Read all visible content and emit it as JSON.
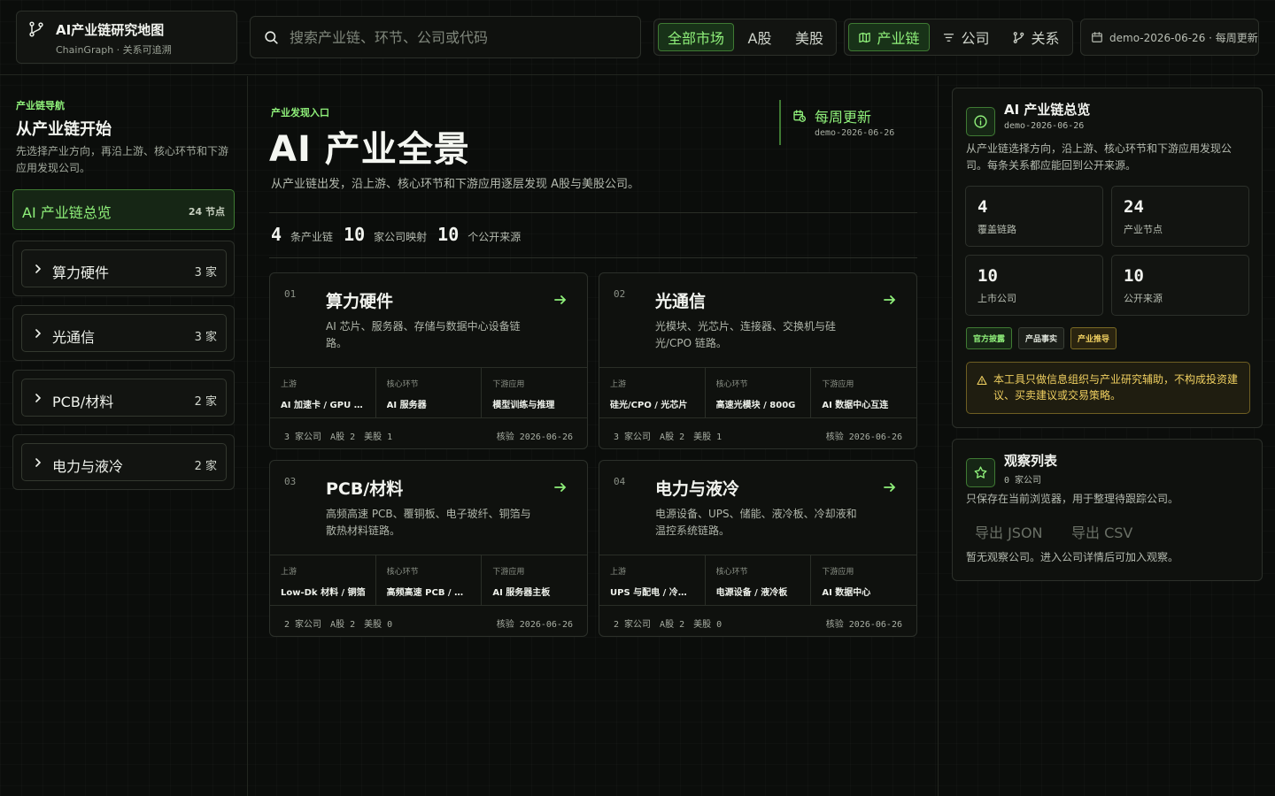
{
  "header": {
    "app_title": "AI产业链研究地图",
    "app_subtitle": "ChainGraph · 关系可追溯",
    "search_placeholder": "搜索产业链、环节、公司或代码",
    "market_tabs": [
      "全部市场",
      "A股",
      "美股"
    ],
    "view_tabs": [
      "产业链",
      "公司",
      "关系"
    ],
    "data_version": "demo-2026-06-26 · 每周更新",
    "accent_color": "#8ff07a"
  },
  "sidebar": {
    "eyebrow": "产业链导航",
    "title": "从产业链开始",
    "description": "先选择产业方向，再沿上游、核心环节和下游应用发现公司。",
    "overview": {
      "label": "AI 产业链总览",
      "count": "24 节点"
    },
    "items": [
      {
        "label": "算力硬件",
        "count": "3 家"
      },
      {
        "label": "光通信",
        "count": "3 家"
      },
      {
        "label": "PCB/材料",
        "count": "2 家"
      },
      {
        "label": "电力与液冷",
        "count": "2 家"
      }
    ]
  },
  "main": {
    "eyebrow": "产业发现入口",
    "title": "AI 产业全景",
    "description": "从产业链出发，沿上游、核心环节和下游应用逐层发现 A股与美股公司。",
    "update": {
      "title": "每周更新",
      "date": "demo-2026-06-26"
    },
    "stats": [
      {
        "num": "4",
        "label": "条产业链"
      },
      {
        "num": "10",
        "label": "家公司映射"
      },
      {
        "num": "10",
        "label": "个公开来源"
      }
    ],
    "link_labels": [
      "上游",
      "核心环节",
      "下游应用"
    ],
    "chains": [
      {
        "no": "01",
        "title": "算力硬件",
        "desc": "AI 芯片、服务器、存储与数据中心设备链路。",
        "upstream": "AI 加速卡 / GPU 芯片",
        "core": "AI 服务器",
        "downstream": "模型训练与推理",
        "companies": "3 家公司",
        "a_share": "A股 2",
        "us_share": "美股 1",
        "verified": "核验 2026-06-26"
      },
      {
        "no": "02",
        "title": "光通信",
        "desc": "光模块、光芯片、连接器、交换机与硅光/CPO 链路。",
        "upstream": "硅光/CPO / 光芯片",
        "core": "高速光模块 / 800G",
        "downstream": "AI 数据中心互连",
        "companies": "3 家公司",
        "a_share": "A股 2",
        "us_share": "美股 1",
        "verified": "核验 2026-06-26"
      },
      {
        "no": "03",
        "title": "PCB/材料",
        "desc": "高频高速 PCB、覆铜板、电子玻纤、铜箔与散热材料链路。",
        "upstream": "Low-Dk 材料 / 铜箔",
        "core": "高频高速 PCB / 覆铜板",
        "downstream": "AI 服务器主板",
        "companies": "2 家公司",
        "a_share": "A股 2",
        "us_share": "美股 0",
        "verified": "核验 2026-06-26"
      },
      {
        "no": "04",
        "title": "电力与液冷",
        "desc": "电源设备、UPS、储能、液冷板、冷却液和温控系统链路。",
        "upstream": "UPS 与配电 / 冷却液",
        "core": "电源设备 / 液冷板",
        "downstream": "AI 数据中心",
        "companies": "2 家公司",
        "a_share": "A股 2",
        "us_share": "美股 0",
        "verified": "核验 2026-06-26"
      }
    ]
  },
  "overview_panel": {
    "title": "AI 产业链总览",
    "date": "demo-2026-06-26",
    "description": "从产业链选择方向，沿上游、核心环节和下游应用发现公司。每条关系都应能回到公开来源。",
    "stats": [
      {
        "num": "4",
        "label": "覆盖链路"
      },
      {
        "num": "24",
        "label": "产业节点"
      },
      {
        "num": "10",
        "label": "上市公司"
      },
      {
        "num": "10",
        "label": "公开来源"
      }
    ],
    "badges": [
      "官方披露",
      "产品事实",
      "产业推导"
    ],
    "disclaimer": "本工具只做信息组织与产业研究辅助，不构成投资建议、买卖建议或交易策略。"
  },
  "watchlist": {
    "title": "观察列表",
    "count": "0 家公司",
    "description": "只保存在当前浏览器，用于整理待跟踪公司。",
    "export_json": "导出 JSON",
    "export_csv": "导出 CSV",
    "empty_text": "暂无观察公司。进入公司详情后可加入观察。"
  }
}
